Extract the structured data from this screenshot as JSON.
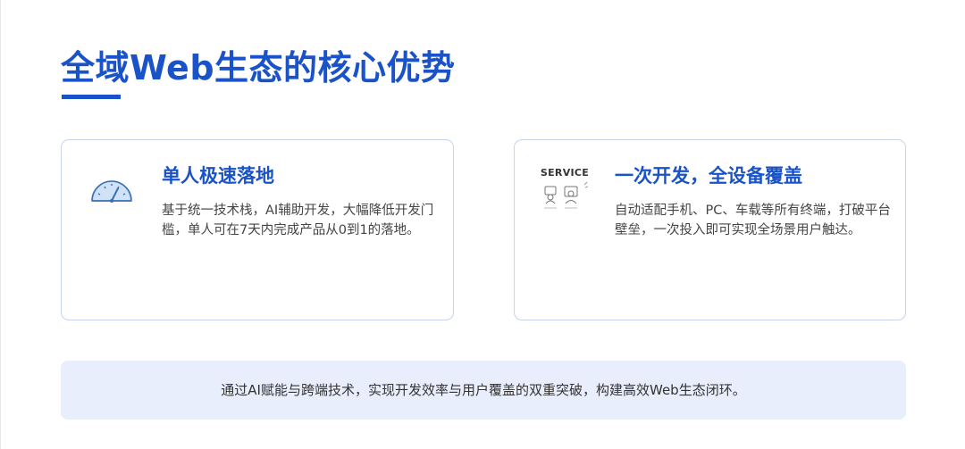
{
  "slide": {
    "title": "全域Web生态的核心优势",
    "cards": [
      {
        "icon": "speedometer-icon",
        "title": "单人极速落地",
        "text": "基于统一技术栈，AI辅助开发，大幅降低开发门槛，单人可在7天内完成产品从0到1的落地。"
      },
      {
        "icon": "service-devices-icon",
        "icon_label": "SERVICE",
        "title": "一次开发，全设备覆盖",
        "text": "自动适配手机、PC、车载等所有终端，打破平台壁垒，一次投入即可实现全场景用户触达。"
      }
    ],
    "summary": "通过AI赋能与跨端技术，实现开发效率与用户覆盖的双重突破，构建高效Web生态闭环。"
  },
  "colors": {
    "accent": "#1a52c7",
    "card_border": "#c7d3ef",
    "summary_bg": "#e8eefb"
  }
}
